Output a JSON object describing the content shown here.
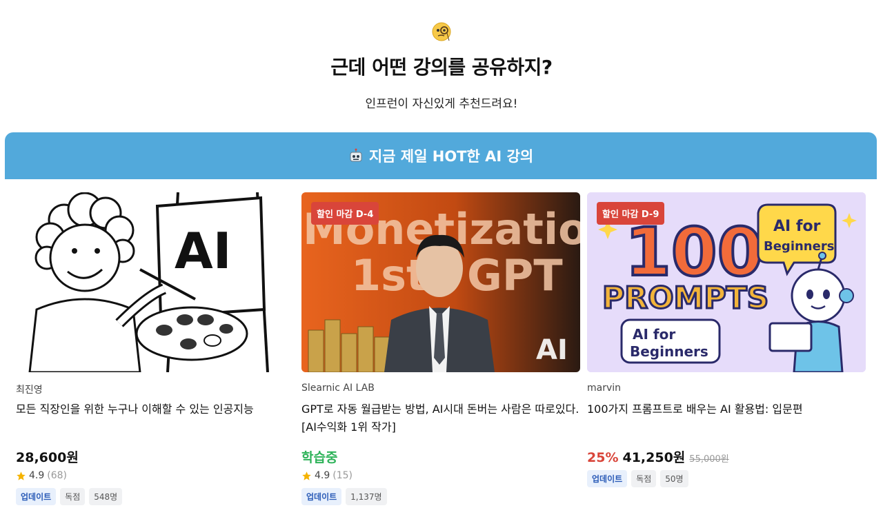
{
  "hero": {
    "emoji": "monocle-face-icon",
    "title": "근데 어떤 강의를 공유하지?",
    "subtitle": "인프런이 자신있게 추천드려요!"
  },
  "banner": {
    "icon": "robot-icon",
    "title": "지금 제일 HOT한 AI 강의",
    "color": "#52a9db"
  },
  "thumbnails": {
    "c1_text": "AI",
    "c2_line1": "Monetization",
    "c2_line2": "1st",
    "c2_line3": "GPT",
    "c2_logo": "AI",
    "c3_big": "100",
    "c3_prompts": "PROMPTS",
    "c3_bubble1": "AI for",
    "c3_bubble2": "Beginners",
    "c3_box1": "AI for",
    "c3_box2": "Beginners"
  },
  "courses": [
    {
      "instructor": "최진영",
      "title": "모든 직장인을 위한 누구나 이해할 수 있는 인공지능",
      "price": "28,600원",
      "rating": "4.9",
      "reviews": "(68)",
      "tags": [
        "업데이트",
        "독점",
        "548명"
      ],
      "badge": ""
    },
    {
      "instructor": "Slearnic AI LAB",
      "title": "GPT로 자동 월급받는 방법, AI시대 돈버는 사람은 따로있다. [AI수익화 1위 작가]",
      "price": "학습중",
      "rating": "4.9",
      "reviews": "(15)",
      "tags": [
        "업데이트",
        "1,137명"
      ],
      "badge": "할인 마감 D-4"
    },
    {
      "instructor": "marvin",
      "title": "100가지 프롬프트로 배우는 AI 활용법: 입문편",
      "discount": "25%",
      "price": "41,250원",
      "original_price": "55,000원",
      "tags": [
        "업데이트",
        "독점",
        "50명"
      ],
      "badge": "할인 마감 D-9"
    }
  ],
  "colors": {
    "discount_red": "#d9453a",
    "learning_green": "#2fb35a",
    "tag_blue": "#2a5bb7"
  }
}
